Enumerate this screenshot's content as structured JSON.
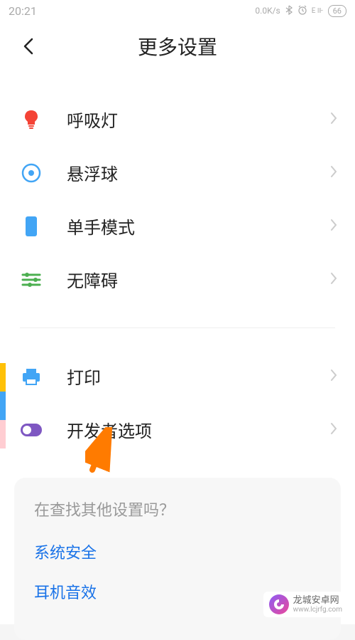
{
  "status": {
    "time": "20:21",
    "speed": "0.0K/s",
    "battery": "66"
  },
  "title": "更多设置",
  "items": [
    {
      "label": "呼吸灯",
      "icon": "bulb",
      "color": "#f44336"
    },
    {
      "label": "悬浮球",
      "icon": "target",
      "color": "#42a5f5"
    },
    {
      "label": "单手模式",
      "icon": "phone",
      "color": "#42a5f5"
    },
    {
      "label": "无障碍",
      "icon": "sliders",
      "color": "#4caf50"
    },
    {
      "label": "打印",
      "icon": "printer",
      "color": "#42a5f5"
    },
    {
      "label": "开发者选项",
      "icon": "toggle",
      "color": "#7e57c2"
    }
  ],
  "search": {
    "title": "在查找其他设置吗？",
    "links": [
      "系统安全",
      "耳机音效"
    ]
  },
  "watermark": {
    "text": "龙城安卓网",
    "sub": "www.lcjrfg.com"
  }
}
